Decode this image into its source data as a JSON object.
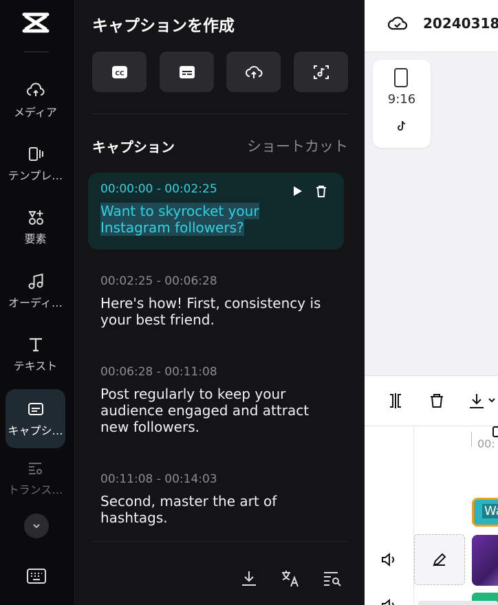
{
  "nav": {
    "items": [
      {
        "label": "メディア",
        "icon": "cloud-upload-icon"
      },
      {
        "label": "テンプレ…",
        "icon": "template-icon"
      },
      {
        "label": "要素",
        "icon": "elements-icon"
      },
      {
        "label": "オーディ…",
        "icon": "music-note-icon"
      },
      {
        "label": "テキスト",
        "icon": "text-icon"
      },
      {
        "label": "キャプシ…",
        "icon": "caption-icon"
      },
      {
        "label": "トランス…",
        "icon": "transcript-icon"
      }
    ]
  },
  "panel": {
    "title": "キャプションを作成",
    "tools": [
      "cc-icon",
      "subtitle-icon",
      "upload-icon",
      "scan-music-icon"
    ],
    "section_title": "キャプション",
    "shortcut_label": "ショートカット",
    "captions": [
      {
        "time": "00:00:00 - 00:02:25",
        "text": "Want to skyrocket your Instagram followers?"
      },
      {
        "time": "00:02:25 - 00:06:28",
        "text": "Here's how! First, consistency is your best friend."
      },
      {
        "time": "00:06:28 - 00:11:08",
        "text": "Post regularly to keep your audience engaged and attract new followers."
      },
      {
        "time": "00:11:08 - 00:14:03",
        "text": "Second, master the art of hashtags."
      }
    ]
  },
  "right": {
    "project_name": "20240318",
    "ratio_label": "9:16",
    "ruler_label": "00:",
    "clip_text": "Wa"
  },
  "colors": {
    "accent": "#2fd3e0",
    "active_bg": "#102a2c",
    "panel_bg": "#141417"
  }
}
